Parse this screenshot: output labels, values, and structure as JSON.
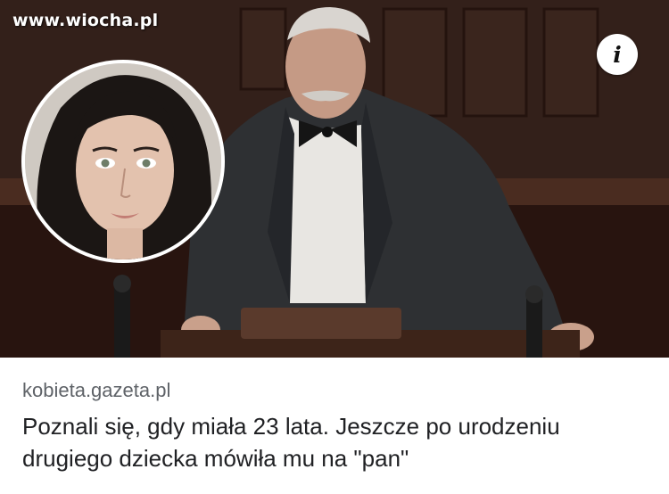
{
  "watermark": {
    "text": "www.wiocha.pl"
  },
  "info_button": {
    "icon": "info-icon",
    "glyph": "i"
  },
  "article": {
    "source": "kobieta.gazeta.pl",
    "headline": "Poznali się, gdy miała 23 lata. Jeszcze po urodzeniu drugiego dziecka mówiła mu na \"pan\""
  },
  "colors": {
    "source_text": "#5f6368",
    "headline_text": "#202124",
    "background": "#ffffff"
  }
}
